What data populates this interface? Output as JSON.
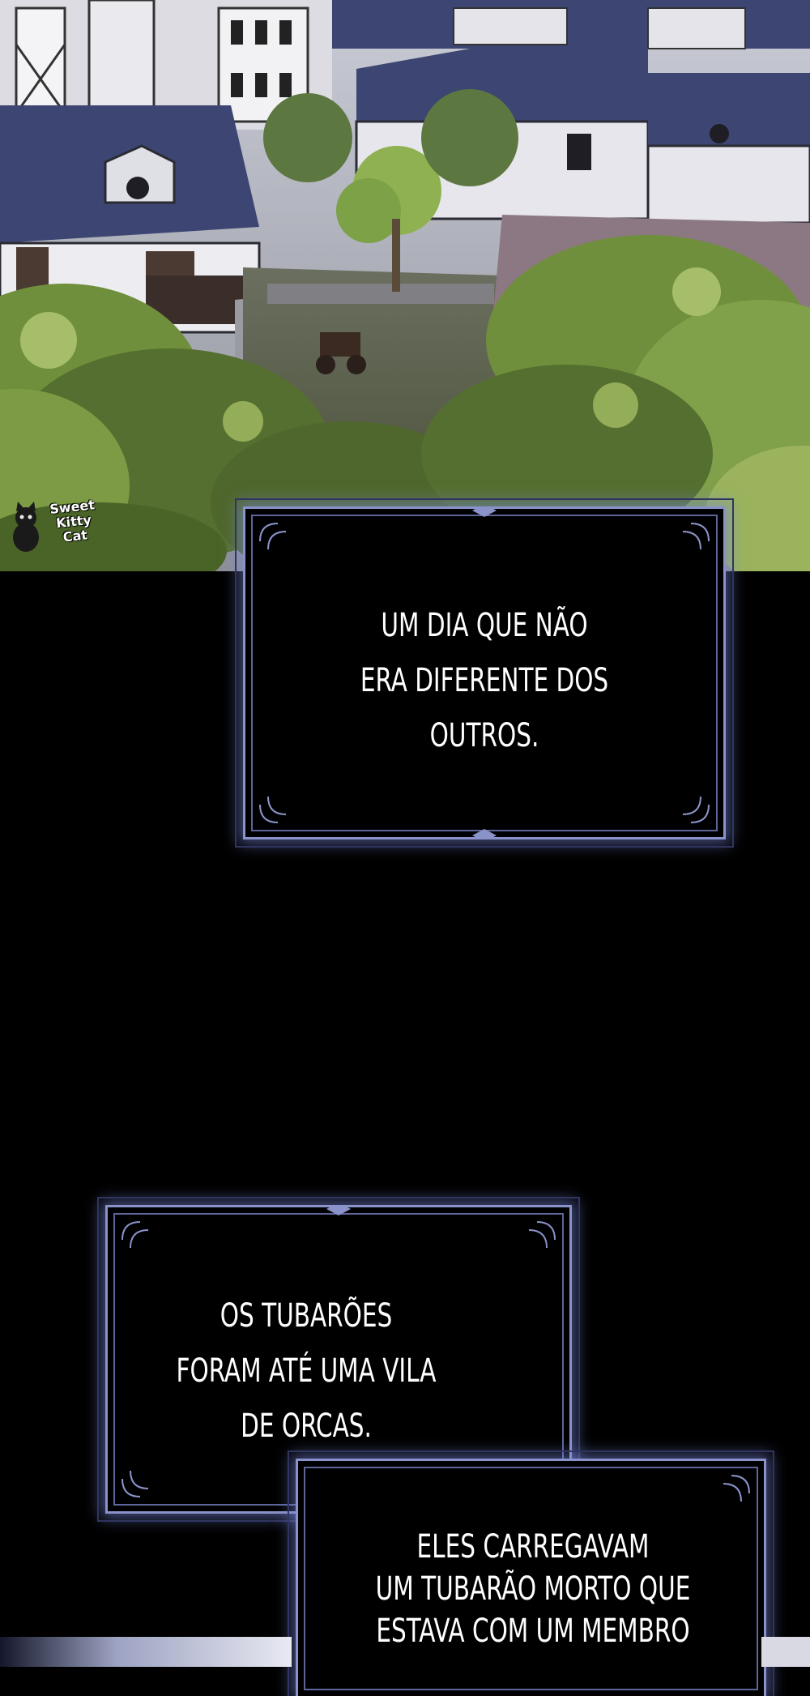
{
  "watermark": {
    "brand": "Sweet Kitty Cat"
  },
  "captions": {
    "box1": {
      "line1": "UM DIA QUE NÃO",
      "line2": "ERA DIFERENTE DOS",
      "line3": "OUTROS."
    },
    "box2": {
      "line1": "OS TUBARÕES",
      "line2": "FORAM ATÉ UMA VILA",
      "line3": "DE ORCAS."
    },
    "box3": {
      "line1": "ELES CARREGAVAM",
      "line2": "UM TUBARÃO MORTO QUE",
      "line3": "ESTAVA COM UM MEMBRO"
    }
  },
  "colors": {
    "background": "#000000",
    "frame_border": "#8a93c9",
    "frame_glow": "#7887dc",
    "caption_text": "#ffffff",
    "roof": "#3d4673",
    "foliage": "#6f8f3c"
  }
}
